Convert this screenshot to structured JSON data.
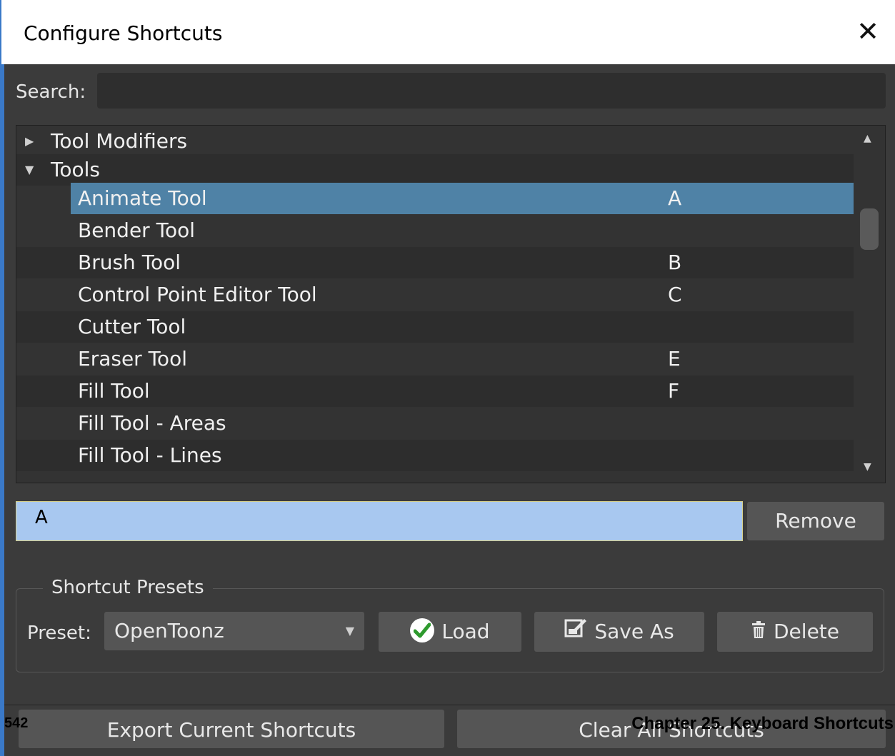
{
  "window": {
    "title": "Configure Shortcuts",
    "close_glyph": "✕"
  },
  "search": {
    "label": "Search:",
    "value": ""
  },
  "tree": {
    "groups": [
      {
        "label": "Tool Modifiers",
        "expanded": false
      },
      {
        "label": "Tools",
        "expanded": true
      }
    ],
    "items": [
      {
        "label": "Animate Tool",
        "shortcut": "A",
        "selected": true
      },
      {
        "label": "Bender Tool",
        "shortcut": ""
      },
      {
        "label": "Brush Tool",
        "shortcut": "B"
      },
      {
        "label": "Control Point Editor Tool",
        "shortcut": "C"
      },
      {
        "label": "Cutter Tool",
        "shortcut": ""
      },
      {
        "label": "Eraser Tool",
        "shortcut": "E"
      },
      {
        "label": "Fill Tool",
        "shortcut": "F"
      },
      {
        "label": "Fill Tool - Areas",
        "shortcut": ""
      },
      {
        "label": "Fill Tool - Lines",
        "shortcut": ""
      }
    ]
  },
  "shortcut_field": {
    "value": "A"
  },
  "remove_label": "Remove",
  "presets": {
    "group_title": "Shortcut Presets",
    "label": "Preset:",
    "selected": "OpenToonz",
    "load_label": "Load",
    "save_as_label": "Save As",
    "delete_label": "Delete"
  },
  "bottom": {
    "export_label": "Export Current Shortcuts",
    "clear_label": "Clear All Shortcuts"
  },
  "page_overlay": {
    "page_number": "542",
    "chapter": "Chapter 25.  Keyboard Shortcuts"
  },
  "colors": {
    "selection": "#4f82a6",
    "shortcut_field": "#a8c8f0",
    "accent_border": "#3a79c8"
  },
  "icons": [
    "close-icon",
    "expand-arrow-icon",
    "collapse-arrow-icon",
    "scroll-up-icon",
    "scroll-down-icon",
    "dropdown-caret-icon",
    "check-icon",
    "save-as-icon",
    "trash-icon"
  ]
}
